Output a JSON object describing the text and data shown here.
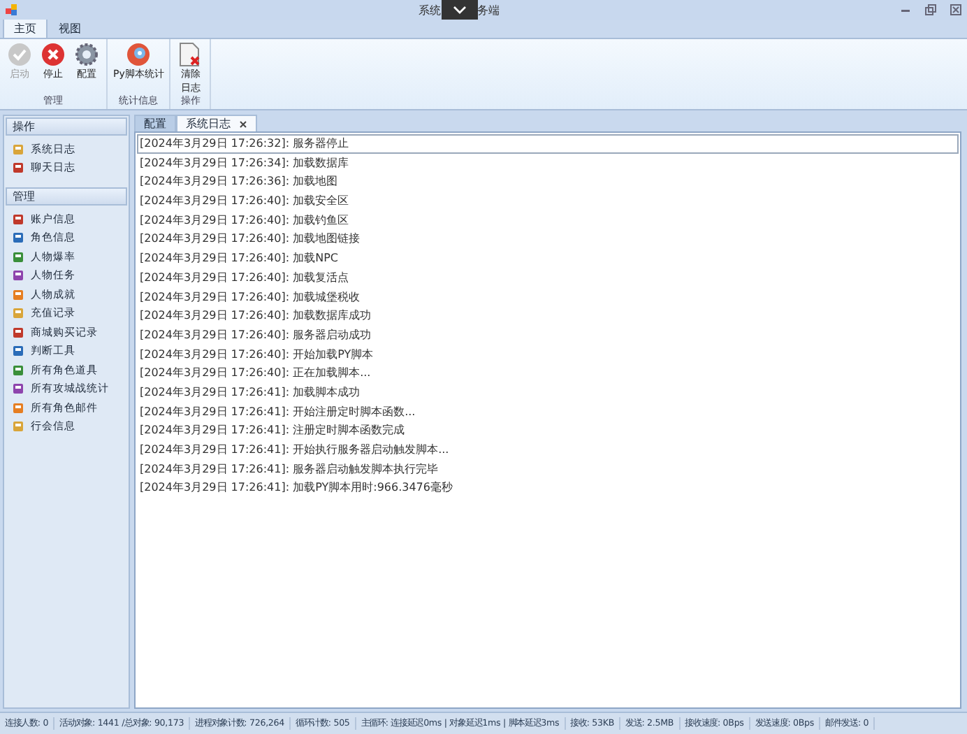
{
  "window": {
    "title_left": "系统",
    "title_right": "务端"
  },
  "ribbon_tabs": [
    {
      "label": "主页",
      "selected": true
    },
    {
      "label": "视图",
      "selected": false
    }
  ],
  "ribbon_groups": [
    {
      "label": "管理",
      "buttons": [
        {
          "label": "启动",
          "kind": "check",
          "disabled": true
        },
        {
          "label": "停止",
          "kind": "stop",
          "disabled": false
        },
        {
          "label": "配置",
          "kind": "gear",
          "disabled": false
        }
      ]
    },
    {
      "label": "统计信息",
      "buttons": [
        {
          "label": "Py脚本统计",
          "kind": "disc",
          "disabled": false
        }
      ]
    },
    {
      "label": "操作",
      "buttons": [
        {
          "lines": [
            "清除",
            "日志"
          ],
          "kind": "doc",
          "disabled": false
        }
      ]
    }
  ],
  "sidebar": [
    {
      "title": "操作",
      "items": [
        "系统日志",
        "聊天日志"
      ]
    },
    {
      "title": "管理",
      "items": [
        "账户信息",
        "角色信息",
        "人物爆率",
        "人物任务",
        "人物成就",
        "充值记录",
        "商城购买记录",
        "判断工具",
        "所有角色道具",
        "所有攻城战统计",
        "所有角色邮件",
        "行会信息"
      ]
    }
  ],
  "doc_tabs": [
    {
      "label": "配置",
      "selected": false,
      "closable": false
    },
    {
      "label": "系统日志",
      "selected": true,
      "closable": true
    }
  ],
  "log": [
    {
      "text": "[2024年3月29日 17:26:32]: 服务器停止",
      "selected": true
    },
    {
      "text": "[2024年3月29日 17:26:34]: 加载数据库",
      "selected": false
    },
    {
      "text": "[2024年3月29日 17:26:36]: 加载地图",
      "selected": false
    },
    {
      "text": "[2024年3月29日 17:26:40]: 加载安全区",
      "selected": false
    },
    {
      "text": "[2024年3月29日 17:26:40]: 加载钓鱼区",
      "selected": false
    },
    {
      "text": "[2024年3月29日 17:26:40]: 加载地图链接",
      "selected": false
    },
    {
      "text": "[2024年3月29日 17:26:40]: 加载NPC",
      "selected": false
    },
    {
      "text": "[2024年3月29日 17:26:40]: 加载复活点",
      "selected": false
    },
    {
      "text": "[2024年3月29日 17:26:40]: 加载城堡税收",
      "selected": false
    },
    {
      "text": "[2024年3月29日 17:26:40]: 加载数据库成功",
      "selected": false
    },
    {
      "text": "[2024年3月29日 17:26:40]: 服务器启动成功",
      "selected": false
    },
    {
      "text": "[2024年3月29日 17:26:40]: 开始加载PY脚本",
      "selected": false
    },
    {
      "text": "[2024年3月29日 17:26:40]: 正在加载脚本...",
      "selected": false
    },
    {
      "text": "[2024年3月29日 17:26:41]: 加载脚本成功",
      "selected": false
    },
    {
      "text": "[2024年3月29日 17:26:41]: 开始注册定时脚本函数...",
      "selected": false
    },
    {
      "text": "[2024年3月29日 17:26:41]: 注册定时脚本函数完成",
      "selected": false
    },
    {
      "text": "[2024年3月29日 17:26:41]: 开始执行服务器启动触发脚本...",
      "selected": false
    },
    {
      "text": "[2024年3月29日 17:26:41]: 服务器启动触发脚本执行完毕",
      "selected": false
    },
    {
      "text": "[2024年3月29日 17:26:41]: 加载PY脚本用时:966.3476毫秒",
      "selected": false
    }
  ],
  "status_bar": [
    "连接人数: 0",
    "活动对象: 1441 /总对象: 90,173",
    "进程对象计数: 726,264",
    "循环计数: 505",
    "主循环: 连接延迟0ms | 对象延迟1ms | 脚本延迟3ms",
    "接收: 53KB",
    "发送: 2.5MB",
    "接收速度: 0Bps",
    "发送速度: 0Bps",
    "邮件发送: 0"
  ]
}
